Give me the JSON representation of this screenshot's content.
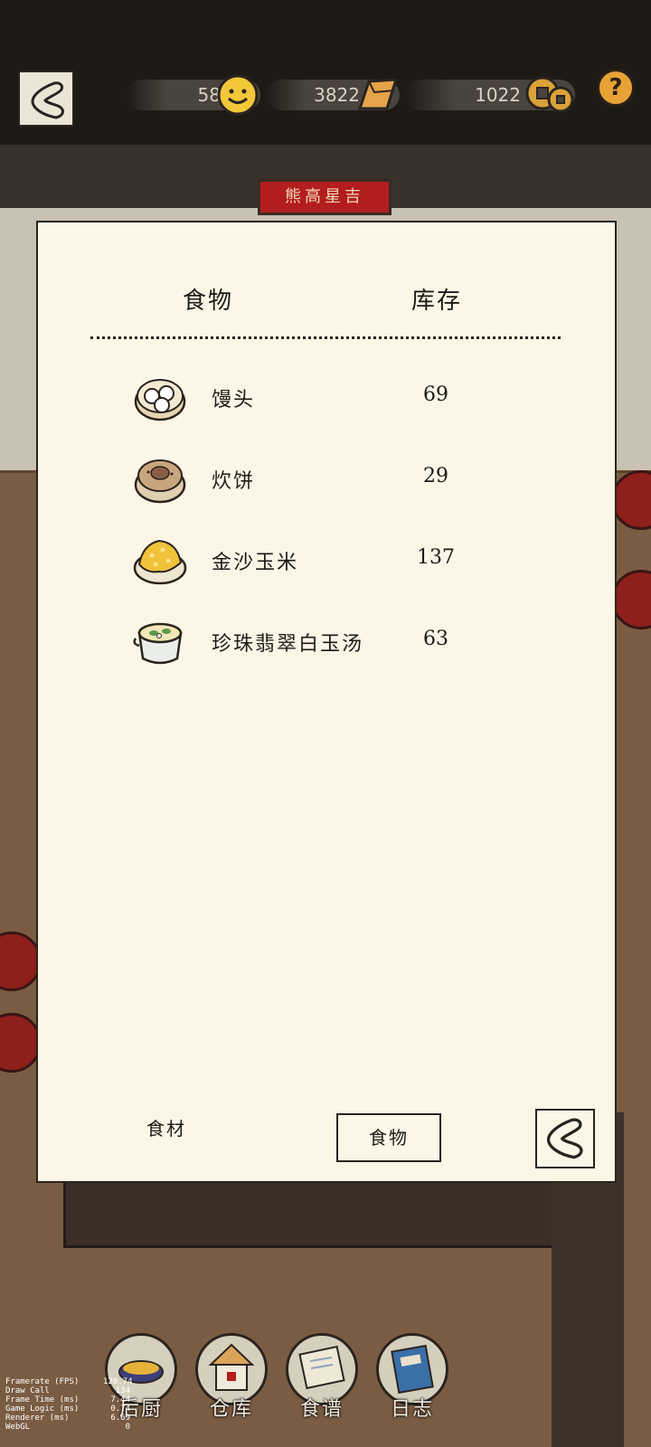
{
  "resources": {
    "happiness": "58",
    "gold": "3822",
    "coins": "1022",
    "help_label": "?"
  },
  "scene": {
    "sign_text": "熊高星吉"
  },
  "dialog": {
    "col_food": "食物",
    "col_stock": "库存",
    "items": [
      {
        "name": "馒头",
        "stock": "69",
        "icon": "steamed-buns-icon"
      },
      {
        "name": "炊饼",
        "stock": "29",
        "icon": "flatbread-icon"
      },
      {
        "name": "金沙玉米",
        "stock": "137",
        "icon": "golden-corn-icon"
      },
      {
        "name": "珍珠翡翠白玉汤",
        "stock": "63",
        "icon": "pearl-jade-soup-icon"
      }
    ],
    "tab_ingredients": "食材",
    "tab_food": "食物"
  },
  "nav": [
    {
      "label": "后厨",
      "icon": "kitchen-icon"
    },
    {
      "label": "仓库",
      "icon": "warehouse-icon"
    },
    {
      "label": "食谱",
      "icon": "recipe-icon"
    },
    {
      "label": "日志",
      "icon": "journal-icon"
    }
  ],
  "debug": {
    "lines": [
      {
        "k": "Framerate (FPS)",
        "v": "120.74"
      },
      {
        "k": "Draw Call",
        "v": "134"
      },
      {
        "k": "Frame Time (ms)",
        "v": "7.44"
      },
      {
        "k": "Game Logic (ms)",
        "v": "0.74"
      },
      {
        "k": "Renderer (ms)",
        "v": "6.69"
      },
      {
        "k": "WebGL",
        "v": "0"
      }
    ]
  },
  "colors": {
    "panel_bg": "#fbf6e6",
    "ink": "#1e1a16",
    "topbar": "#1e1a16",
    "accent_red": "#b31d1d",
    "gold": "#e7a336"
  }
}
